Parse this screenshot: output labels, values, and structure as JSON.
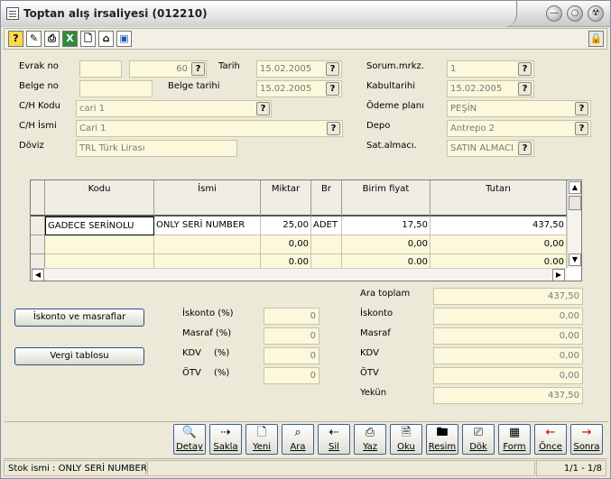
{
  "window": {
    "title": "Toptan alış irsaliyesi (012210)",
    "min": "—",
    "max": "○",
    "close": "☢"
  },
  "toolbar": {
    "icons": [
      "help-icon",
      "edit-icon",
      "print-icon",
      "excel-icon",
      "new-doc-icon",
      "home-icon",
      "screen-icon"
    ],
    "lock": "lock-icon"
  },
  "form": {
    "evrak_no_label": "Evrak no",
    "evrak_no_value": "",
    "seq_value": "60",
    "tarih_label": "Tarih",
    "tarih_value": "15.02.2005",
    "belge_no_label": "Belge no",
    "belge_no_value": "",
    "belge_tarihi_label": "Belge tarihi",
    "belge_tarihi_value": "15.02.2005",
    "ch_kodu_label": "C/H Kodu",
    "ch_kodu_value": "cari 1",
    "ch_ismi_label": "C/H İsmi",
    "ch_ismi_value": "Cari 1",
    "doviz_label": "Döviz",
    "doviz_value": "TRL Türk Lirası",
    "sorum_label": "Sorum.mrkz.",
    "sorum_value": "1",
    "kabul_label": "Kabultarihi",
    "kabul_value": "15.02.2005",
    "odeme_label": "Ödeme planı",
    "odeme_value": "PEŞİN",
    "depo_label": "Depo",
    "depo_value": "Antrepo 2",
    "sat_label": "Sat.almacı.",
    "sat_value": "SATIN ALMACI",
    "q": "?"
  },
  "grid": {
    "headers": [
      "Kodu",
      "İsmi",
      "Miktar",
      "Br",
      "Birim fiyat",
      "Tutarı"
    ],
    "rows": [
      {
        "kodu": "GADECE SERİNOLU",
        "ismi": "ONLY SERİ NUMBER",
        "miktar": "25,00",
        "br": "ADET",
        "fiyat": "17,50",
        "tutar": "437,50"
      },
      {
        "kodu": "",
        "ismi": "",
        "miktar": "0,00",
        "br": "",
        "fiyat": "0,00",
        "tutar": "0,00"
      },
      {
        "kodu": "",
        "ismi": "",
        "miktar": "0.00",
        "br": "",
        "fiyat": "0.00",
        "tutar": "0.00"
      }
    ]
  },
  "left": {
    "iskonto_btn": "İskonto ve masraflar",
    "vergi_btn": "Vergi tablosu",
    "iskonto_label": "İskonto  (%)",
    "iskonto_val": "0",
    "masraf_label": "Masraf  (%)",
    "masraf_val": "0",
    "kdv_label": "KDV",
    "kdv_pct": "(%)",
    "kdv_val": "0",
    "otv_label": "ÖTV",
    "otv_pct": "(%)",
    "otv_val": "0"
  },
  "totals": {
    "ara_label": "Ara toplam",
    "ara_val": "437,50",
    "iskonto_label": "İskonto",
    "iskonto_val": "0,00",
    "masraf_label": "Masraf",
    "masraf_val": "0,00",
    "kdv_label": "KDV",
    "kdv_val": "0,00",
    "otv_label": "ÖTV",
    "otv_val": "0,00",
    "yekun_label": "Yekün",
    "yekun_val": "437,50"
  },
  "buttons": [
    {
      "label": "Detay",
      "icon": "🔍",
      "name": "detay-button"
    },
    {
      "label": "Sakla",
      "icon": "⇢",
      "name": "sakla-button"
    },
    {
      "label": "Yeni",
      "icon": "🗋",
      "name": "yeni-button"
    },
    {
      "label": "Ara",
      "icon": "⌕",
      "name": "ara-button"
    },
    {
      "label": "Sil",
      "icon": "⇠",
      "name": "sil-button"
    },
    {
      "label": "Yaz",
      "icon": "⎙",
      "name": "yaz-button"
    },
    {
      "label": "Oku",
      "icon": "🗎",
      "name": "oku-button"
    },
    {
      "label": "Resim",
      "icon": "🖿",
      "name": "resim-button"
    },
    {
      "label": "Dök",
      "icon": "⎚",
      "name": "dok-button"
    },
    {
      "label": "Form",
      "icon": "▦",
      "name": "form-button"
    },
    {
      "label": "Önce",
      "icon": "←",
      "name": "once-button"
    },
    {
      "label": "Sonra",
      "icon": "→",
      "name": "sonra-button"
    }
  ],
  "status": {
    "left": "Stok ismi : ONLY SERİ NUMBER",
    "right": "1/1 - 1/8"
  }
}
